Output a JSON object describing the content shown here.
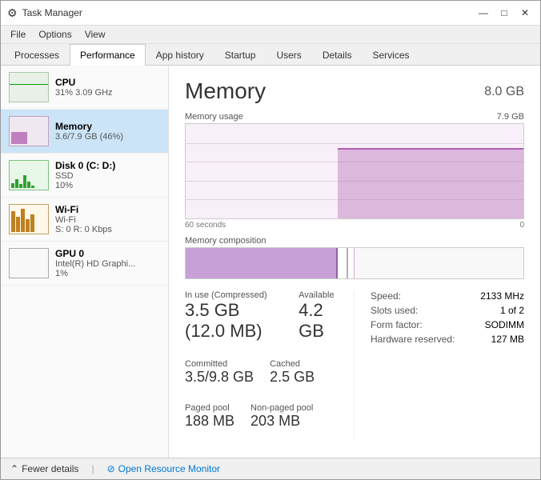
{
  "window": {
    "title": "Task Manager",
    "icon": "⚙"
  },
  "title_controls": {
    "minimize": "—",
    "maximize": "□",
    "close": "✕"
  },
  "menu": {
    "items": [
      "File",
      "Options",
      "View"
    ]
  },
  "tabs": [
    {
      "label": "Processes",
      "active": false
    },
    {
      "label": "Performance",
      "active": true
    },
    {
      "label": "App history",
      "active": false
    },
    {
      "label": "Startup",
      "active": false
    },
    {
      "label": "Users",
      "active": false
    },
    {
      "label": "Details",
      "active": false
    },
    {
      "label": "Services",
      "active": false
    }
  ],
  "sidebar": {
    "items": [
      {
        "id": "cpu",
        "title": "CPU",
        "subtitle1": "31% 3.09 GHz",
        "subtitle2": "",
        "active": false
      },
      {
        "id": "memory",
        "title": "Memory",
        "subtitle1": "3.6/7.9 GB (46%)",
        "subtitle2": "",
        "active": true
      },
      {
        "id": "disk",
        "title": "Disk 0 (C: D:)",
        "subtitle1": "SSD",
        "subtitle2": "10%",
        "active": false
      },
      {
        "id": "wifi",
        "title": "Wi-Fi",
        "subtitle1": "Wi-Fi",
        "subtitle2": "S: 0 R: 0 Kbps",
        "active": false
      },
      {
        "id": "gpu",
        "title": "GPU 0",
        "subtitle1": "Intel(R) HD Graphi...",
        "subtitle2": "1%",
        "active": false
      }
    ]
  },
  "main": {
    "title": "Memory",
    "total": "8.0 GB",
    "chart": {
      "label": "Memory usage",
      "max_label": "7.9 GB",
      "time_left": "60 seconds",
      "time_right": "0"
    },
    "composition_label": "Memory composition",
    "stats": {
      "in_use_label": "In use (Compressed)",
      "in_use_value": "3.5 GB (12.0 MB)",
      "available_label": "Available",
      "available_value": "4.2 GB",
      "committed_label": "Committed",
      "committed_value": "3.5/9.8 GB",
      "cached_label": "Cached",
      "cached_value": "2.5 GB",
      "paged_label": "Paged pool",
      "paged_value": "188 MB",
      "nonpaged_label": "Non-paged pool",
      "nonpaged_value": "203 MB",
      "speed_label": "Speed:",
      "speed_value": "2133 MHz",
      "slots_label": "Slots used:",
      "slots_value": "1 of 2",
      "form_label": "Form factor:",
      "form_value": "SODIMM",
      "hw_label": "Hardware reserved:",
      "hw_value": "127 MB"
    }
  },
  "bottom": {
    "fewer_details": "Fewer details",
    "open_resource": "Open Resource Monitor"
  }
}
